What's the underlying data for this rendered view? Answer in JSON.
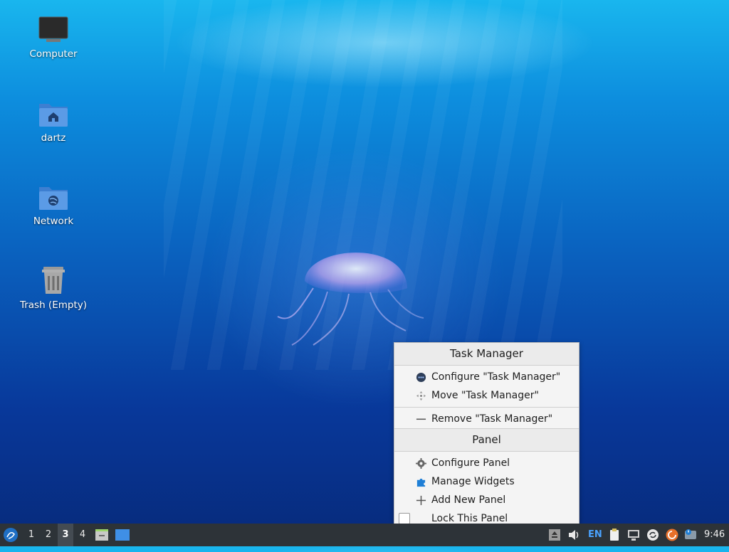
{
  "desktop": {
    "icons": [
      {
        "label": "Computer",
        "icon": "computer-icon"
      },
      {
        "label": "dartz",
        "icon": "home-folder-icon"
      },
      {
        "label": "Network",
        "icon": "network-folder-icon"
      },
      {
        "label": "Trash (Empty)",
        "icon": "trash-icon"
      }
    ]
  },
  "context_menu": {
    "section1_title": "Task Manager",
    "configure_task_manager": "Configure \"Task Manager\"",
    "move_task_manager": "Move \"Task Manager\"",
    "remove_task_manager": "Remove \"Task Manager\"",
    "section2_title": "Panel",
    "configure_panel": "Configure Panel",
    "manage_widgets": "Manage Widgets",
    "add_new_panel": "Add New Panel",
    "lock_this_panel": "Lock This Panel",
    "lock_checked": false
  },
  "taskbar": {
    "desktops": [
      "1",
      "2",
      "3",
      "4"
    ],
    "active_desktop": "3",
    "keyboard_layout": "EN",
    "clock": "9:46"
  },
  "colors": {
    "taskbar_bg": "#2d3338",
    "menu_bg": "#f4f4f4",
    "accent_blue": "#1f7fd6"
  }
}
